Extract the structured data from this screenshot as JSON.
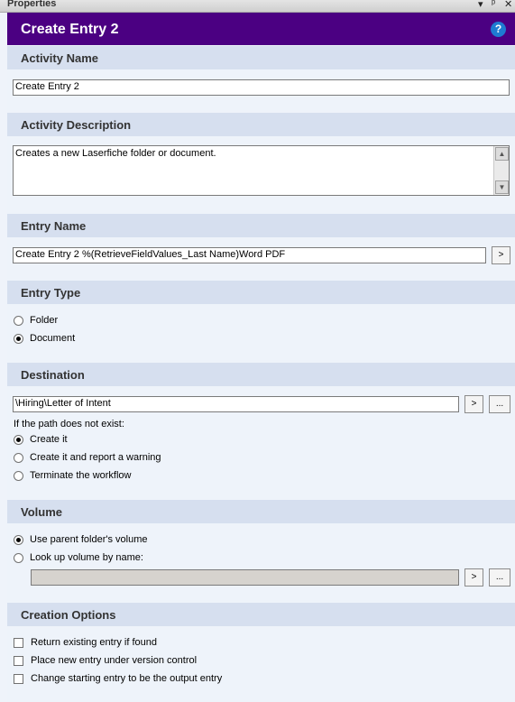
{
  "panel": {
    "title": "Properties",
    "pin_label": "▾ ⊥ ✕"
  },
  "header": {
    "title": "Create Entry 2",
    "help_label": "?"
  },
  "sections": {
    "activity_name": {
      "heading": "Activity Name",
      "value": "Create Entry 2"
    },
    "activity_description": {
      "heading": "Activity Description",
      "value": "Creates a new Laserfiche folder or document."
    },
    "entry_name": {
      "heading": "Entry Name",
      "value": "Create Entry 2 %(RetrieveFieldValues_Last Name)Word PDF",
      "browse": ">"
    },
    "entry_type": {
      "heading": "Entry Type",
      "options": [
        {
          "label": "Folder",
          "selected": false
        },
        {
          "label": "Document",
          "selected": true
        }
      ]
    },
    "destination": {
      "heading": "Destination",
      "value": "\\Hiring\\Letter of Intent",
      "token_button": ">",
      "browse_button": "...",
      "if_not_exist": "If the path does not exist:",
      "options": [
        {
          "label": "Create it",
          "selected": true
        },
        {
          "label": "Create it and report a warning",
          "selected": false
        },
        {
          "label": "Terminate the workflow",
          "selected": false
        }
      ]
    },
    "volume": {
      "heading": "Volume",
      "options": [
        {
          "label": "Use parent folder's volume",
          "selected": true
        },
        {
          "label": "Look up volume by name:",
          "selected": false
        }
      ],
      "value": "",
      "token_button": ">",
      "browse_button": "..."
    },
    "creation_options": {
      "heading": "Creation Options",
      "options": [
        {
          "label": "Return existing entry if found",
          "checked": false
        },
        {
          "label": "Place new entry under version control",
          "checked": false
        },
        {
          "label": "Change starting entry to be the output entry",
          "checked": false
        }
      ]
    }
  }
}
